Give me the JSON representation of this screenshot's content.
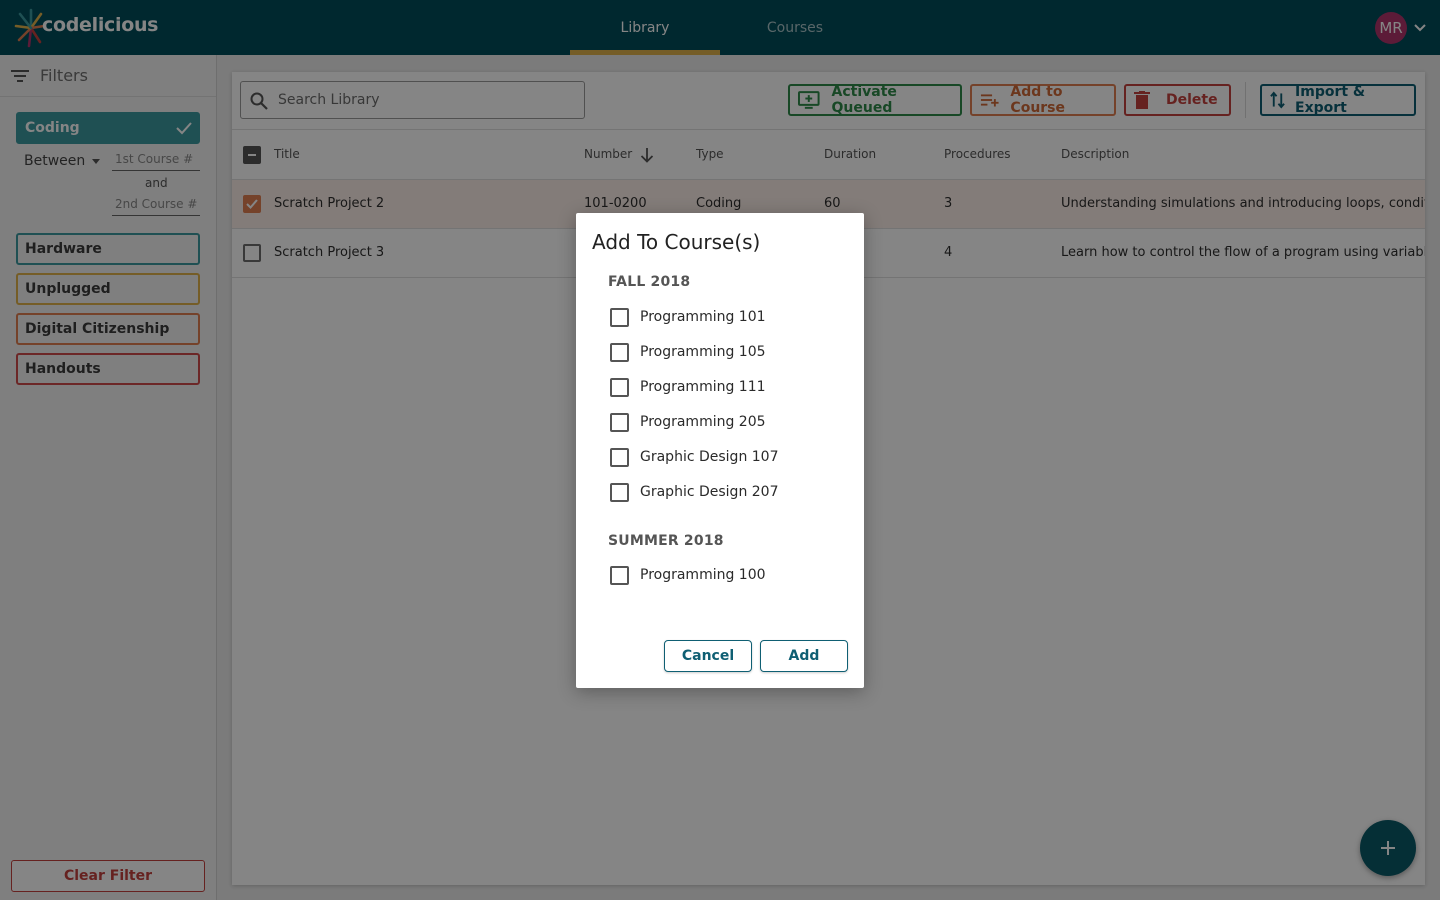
{
  "app": {
    "logo_text": "codelicious",
    "nav_tabs": [
      {
        "label": "Library",
        "active": true
      },
      {
        "label": "Courses",
        "active": false
      }
    ],
    "user_initials": "MR"
  },
  "sidebar": {
    "title": "Filters",
    "chips": [
      {
        "label": "Coding",
        "selected": true
      },
      {
        "label": "Hardware",
        "selected": false
      },
      {
        "label": "Unplugged",
        "selected": false
      },
      {
        "label": "Digital Citizenship",
        "selected": false
      },
      {
        "label": "Handouts",
        "selected": false
      }
    ],
    "range": {
      "operator": "Between",
      "first_placeholder": "1st Course #",
      "and_label": "and",
      "second_placeholder": "2nd Course #"
    },
    "clear_label": "Clear Filter"
  },
  "toolbar": {
    "search_placeholder": "Search Library",
    "activate_label": "Activate Queued",
    "add_to_course_label": "Add to Course",
    "delete_label": "Delete",
    "import_export_label": "Import & Export"
  },
  "table": {
    "columns": [
      "Title",
      "Number",
      "Type",
      "Duration",
      "Procedures",
      "Description"
    ],
    "sorted_column": "Number",
    "rows": [
      {
        "selected": true,
        "title": "Scratch Project 2",
        "number": "101-0200",
        "type": "Coding",
        "duration": "60",
        "procedures": "3",
        "description": "Understanding simulations  and introducing loops, conditionals"
      },
      {
        "selected": false,
        "title": "Scratch Project 3",
        "number": "",
        "type": "",
        "duration": "",
        "procedures": "4",
        "description": "Learn how to control the flow of a program using variables, functions"
      }
    ]
  },
  "modal": {
    "title": "Add To Course(s)",
    "groups": [
      {
        "label": "FALL 2018",
        "courses": [
          "Programming 101",
          "Programming 105",
          "Programming 111",
          "Programming 205",
          "Graphic Design 107",
          "Graphic Design 207"
        ]
      },
      {
        "label": "SUMMER 2018",
        "courses": [
          "Programming 100"
        ]
      }
    ],
    "cancel_label": "Cancel",
    "add_label": "Add"
  },
  "colors": {
    "topbar": "#004d5a",
    "accent_teal": "#3c9aa0",
    "accent_yellow": "#e0b24b",
    "accent_orange": "#e07f52",
    "accent_red": "#c4413f",
    "accent_green": "#2f8b4a",
    "primary_dark": "#0f5f73"
  }
}
